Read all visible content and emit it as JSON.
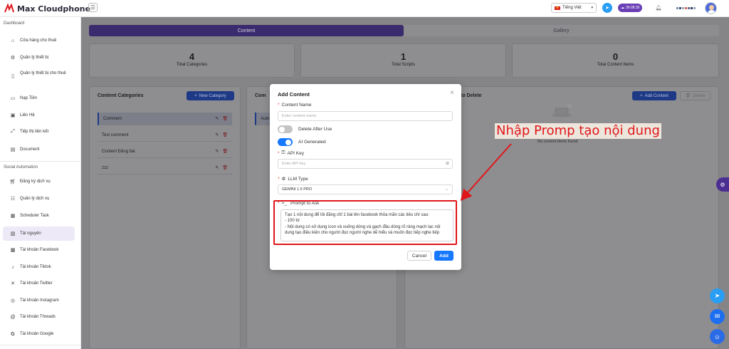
{
  "app": {
    "name": "Max Cloudphone"
  },
  "topbar": {
    "language": "Tiếng Việt",
    "balance": "39.08.30"
  },
  "sidebar": {
    "sections": [
      {
        "title": "Dashboard"
      },
      {
        "title": "Social Automation"
      }
    ],
    "items": [
      {
        "label": "Cửa hàng cho thuê",
        "icon": "store-icon"
      },
      {
        "label": "Quản lý thiết bị",
        "icon": "device-icon"
      },
      {
        "label": "Quản lý thiết bị cho thuê",
        "icon": "rented-device-icon"
      },
      {
        "label": "Nạp Tiền",
        "icon": "wallet-icon"
      },
      {
        "label": "Liên Hệ",
        "icon": "contact-icon"
      },
      {
        "label": "Tiếp thị liên kết",
        "icon": "affiliate-icon"
      },
      {
        "label": "Document",
        "icon": "document-icon"
      },
      {
        "label": "Đăng ký dịch vụ",
        "icon": "cart-icon"
      },
      {
        "label": "Quản lý dịch vụ",
        "icon": "service-icon"
      },
      {
        "label": "Scheduler Task",
        "icon": "calendar-icon"
      },
      {
        "label": "Tài nguyên",
        "icon": "resource-icon"
      },
      {
        "label": "Tài khoản Facebook",
        "icon": "facebook-icon"
      },
      {
        "label": "Tài khoản Tiktok",
        "icon": "tiktok-icon"
      },
      {
        "label": "Tài khoản Twitter",
        "icon": "x-icon"
      },
      {
        "label": "Tài khoản Instagram",
        "icon": "instagram-icon"
      },
      {
        "label": "Tài khoản Threads",
        "icon": "threads-icon"
      },
      {
        "label": "Tài khoản Google",
        "icon": "google-icon"
      }
    ]
  },
  "tabs": {
    "content": "Content",
    "gallery": "Gallery"
  },
  "stats": [
    {
      "value": "4",
      "label": "Total Categories"
    },
    {
      "value": "1",
      "label": "Total Scripts"
    },
    {
      "value": "0",
      "label": "Total Content Items"
    }
  ],
  "categories_panel": {
    "title": "Content Categories",
    "new_button": "New Category",
    "items": [
      "Comment",
      "Test comment",
      "Content Đăng bài",
      "zzz"
    ]
  },
  "middle_panel": {
    "title": "Com",
    "item": "Auto"
  },
  "right_panel": {
    "title": "to Delete",
    "add_button": "Add Content",
    "delete_button": "Delete",
    "empty": "No content items found"
  },
  "modal": {
    "title": "Add Content",
    "content_name_label": "Content Name",
    "content_name_placeholder": "Enter content name",
    "delete_after_use": "Delete After Use",
    "ai_generated": "AI Generated",
    "api_key_label": "API Key",
    "api_key_placeholder": "Enter API key",
    "llm_type_label": "LLM Type",
    "llm_type_value": "GEMINI 1.5 PRO",
    "prompt_label": "Prompt to Ask",
    "prompt_lines": [
      "Tạo 1 nội dung để tôi đăng chỉ 1 bài lên facebook thỏa mãn các tiêu chí sau:",
      "- 100 từ",
      "- Nội dung có sử dụng icon và xuống dòng và gạch đầu dòng rõ ràng mạch lạc nội",
      "dung tạo điều kiện cho người đọc người nghe dễ hiểu và muốn đọc tiếp nghe tiếp"
    ],
    "cancel": "Cancel",
    "add": "Add"
  },
  "annotation": {
    "text": "Nhập Promp tạo nội dung",
    "color": "#e0161b"
  },
  "colors": {
    "primary": "#1677ff",
    "brand": "#4a2e92",
    "danger": "#e0161b"
  }
}
